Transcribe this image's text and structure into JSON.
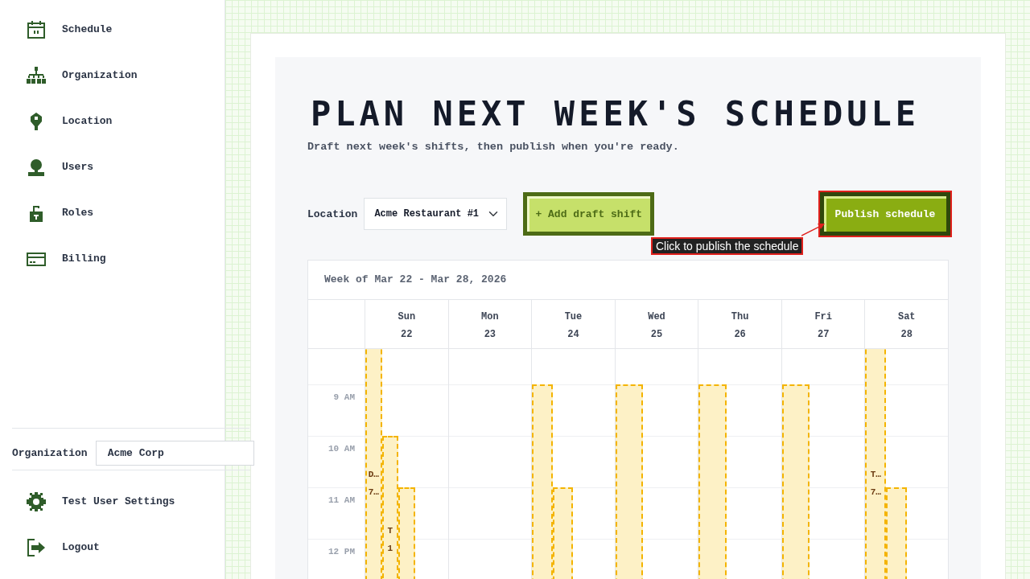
{
  "sidebar": {
    "items": [
      {
        "label": "Schedule"
      },
      {
        "label": "Organization"
      },
      {
        "label": "Location"
      },
      {
        "label": "Users"
      },
      {
        "label": "Roles"
      },
      {
        "label": "Billing"
      }
    ],
    "organization": {
      "label": "Organization",
      "value": "Acme Corp"
    },
    "footer_items": [
      {
        "label": "Test User Settings"
      },
      {
        "label": "Logout"
      }
    ]
  },
  "page": {
    "title": "PLAN NEXT WEEK'S SCHEDULE",
    "subtitle": "Draft next week's shifts, then publish when you're ready.",
    "location": {
      "label": "Location",
      "value": "Acme Restaurant #1"
    },
    "add_button": "+ Add draft shift",
    "publish_button": "Publish schedule",
    "tooltip": "Click to publish the schedule"
  },
  "calendar": {
    "week": "Week of Mar 22 - Mar 28, 2026",
    "times": [
      "9 AM",
      "10 AM",
      "11 AM",
      "12 PM"
    ],
    "days": [
      {
        "weekday": "Sun",
        "date": "22",
        "shifts": [
          {
            "kind": "early",
            "lines": [
              "D…",
              "7…"
            ]
          },
          {
            "kind": "ten",
            "lines": [
              "T",
              "1"
            ]
          },
          {
            "kind": "eleven"
          }
        ]
      },
      {
        "weekday": "Mon",
        "date": "23"
      },
      {
        "weekday": "Tue",
        "date": "24",
        "shifts": [
          {
            "kind": "nine"
          },
          {
            "kind": "eleven"
          }
        ]
      },
      {
        "weekday": "Wed",
        "date": "25",
        "shifts": [
          {
            "kind": "nine"
          }
        ]
      },
      {
        "weekday": "Thu",
        "date": "26",
        "shifts": [
          {
            "kind": "nine"
          }
        ]
      },
      {
        "weekday": "Fri",
        "date": "27",
        "shifts": [
          {
            "kind": "nine"
          }
        ]
      },
      {
        "weekday": "Sat",
        "date": "28",
        "shifts": [
          {
            "kind": "early",
            "lines": [
              "T…",
              "7…"
            ]
          },
          {
            "kind": "eleven"
          }
        ]
      }
    ]
  }
}
